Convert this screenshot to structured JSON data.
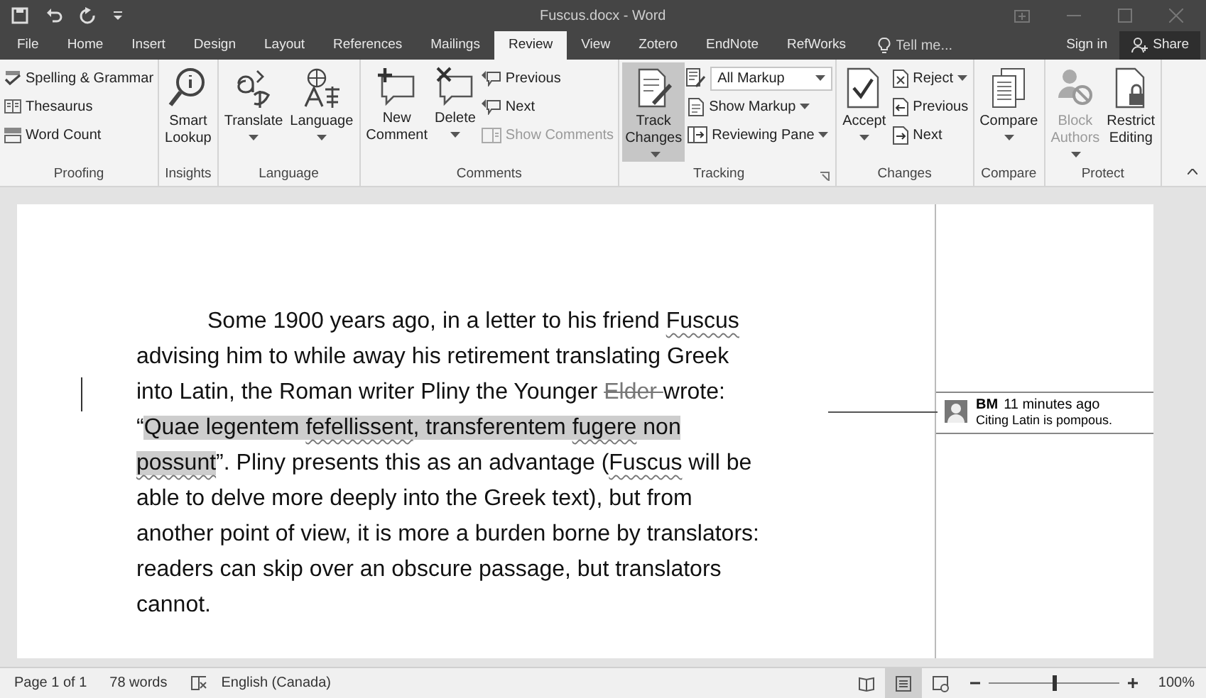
{
  "window": {
    "title": "Fuscus.docx - Word"
  },
  "tabs": [
    {
      "label": "File",
      "selected": false
    },
    {
      "label": "Home",
      "selected": false
    },
    {
      "label": "Insert",
      "selected": false
    },
    {
      "label": "Design",
      "selected": false
    },
    {
      "label": "Layout",
      "selected": false
    },
    {
      "label": "References",
      "selected": false
    },
    {
      "label": "Mailings",
      "selected": false
    },
    {
      "label": "Review",
      "selected": true
    },
    {
      "label": "View",
      "selected": false
    },
    {
      "label": "Zotero",
      "selected": false
    },
    {
      "label": "EndNote",
      "selected": false
    },
    {
      "label": "RefWorks",
      "selected": false
    }
  ],
  "tell_me": {
    "placeholder": "Tell me..."
  },
  "sign_in": "Sign in",
  "share": "Share",
  "ribbon": {
    "groups": [
      {
        "label": "Proofing",
        "items": [
          {
            "kind": "stack",
            "items": [
              {
                "label": "Spelling & Grammar",
                "kind": "small",
                "disabled": false,
                "pressed": false,
                "dropdown": false
              },
              {
                "label": "Thesaurus",
                "kind": "small",
                "disabled": false,
                "pressed": false,
                "dropdown": false
              },
              {
                "label": "Word Count",
                "kind": "small",
                "disabled": false,
                "pressed": false,
                "dropdown": false
              }
            ]
          }
        ]
      },
      {
        "label": "Insights",
        "items": [
          {
            "kind": "large",
            "label": "Smart Lookup",
            "disabled": false,
            "pressed": false,
            "dropdown": false
          }
        ]
      },
      {
        "label": "Language",
        "items": [
          {
            "kind": "large",
            "label": "Translate",
            "disabled": false,
            "pressed": false,
            "dropdown": true
          },
          {
            "kind": "large",
            "label": "Language",
            "disabled": false,
            "pressed": false,
            "dropdown": true
          }
        ]
      },
      {
        "label": "Comments",
        "items": [
          {
            "kind": "large",
            "label": "New Comment",
            "disabled": false,
            "pressed": false,
            "dropdown": false
          },
          {
            "kind": "large",
            "label": "Delete",
            "disabled": false,
            "pressed": false,
            "dropdown": true
          },
          {
            "kind": "stack",
            "items": [
              {
                "label": "Previous",
                "kind": "small",
                "disabled": false,
                "pressed": false,
                "dropdown": false
              },
              {
                "label": "Next",
                "kind": "small",
                "disabled": false,
                "pressed": false,
                "dropdown": false
              },
              {
                "label": "Show Comments",
                "kind": "small",
                "disabled": true,
                "pressed": false,
                "dropdown": false
              }
            ]
          }
        ]
      },
      {
        "label": "Tracking",
        "items": [
          {
            "kind": "large",
            "label": "Track Changes",
            "disabled": false,
            "pressed": true,
            "dropdown": true
          },
          {
            "kind": "stack",
            "items": [
              {
                "label": "All Markup",
                "kind": "select",
                "disabled": false,
                "pressed": false,
                "dropdown": true
              },
              {
                "label": "Show Markup",
                "kind": "small",
                "disabled": false,
                "pressed": false,
                "dropdown": true
              },
              {
                "label": "Reviewing Pane",
                "kind": "small",
                "disabled": false,
                "pressed": false,
                "dropdown": true
              }
            ]
          }
        ]
      },
      {
        "label": "Changes",
        "items": [
          {
            "kind": "large",
            "label": "Accept",
            "disabled": false,
            "pressed": false,
            "dropdown": true
          },
          {
            "kind": "stack",
            "items": [
              {
                "label": "Reject",
                "kind": "small",
                "disabled": false,
                "pressed": false,
                "dropdown": true
              },
              {
                "label": "Previous",
                "kind": "small",
                "disabled": false,
                "pressed": false,
                "dropdown": false
              },
              {
                "label": "Next",
                "kind": "small",
                "disabled": false,
                "pressed": false,
                "dropdown": false
              }
            ]
          }
        ]
      },
      {
        "label": "Compare",
        "items": [
          {
            "kind": "large",
            "label": "Compare",
            "disabled": false,
            "pressed": false,
            "dropdown": true
          }
        ]
      },
      {
        "label": "Protect",
        "items": [
          {
            "kind": "large",
            "label": "Block Authors",
            "disabled": true,
            "pressed": false,
            "dropdown": true
          },
          {
            "kind": "large",
            "label": "Restrict Editing",
            "disabled": false,
            "pressed": false,
            "dropdown": false
          }
        ]
      }
    ]
  },
  "document": {
    "paragraph": [
      [
        {
          "text": "Some 1900 years ago, in a letter to his friend ",
          "kind": "normal"
        },
        {
          "text": "Fuscus",
          "kind": "misspelled"
        }
      ],
      [
        {
          "text": "advising him to while away his retirement translating Greek",
          "kind": "normal"
        }
      ],
      [
        {
          "text": "into Latin, the Roman writer Pliny the Younger ",
          "kind": "normal"
        },
        {
          "text": "Elder ",
          "kind": "deleted"
        },
        {
          "text": "wrote:",
          "kind": "normal"
        }
      ],
      [
        {
          "text": "“",
          "kind": "normal"
        },
        {
          "text": "Quae legentem ",
          "kind": "comment"
        },
        {
          "text": "fefellissent",
          "kind": "comment-misspelled"
        },
        {
          "text": ", transferentem ",
          "kind": "comment"
        },
        {
          "text": "fugere",
          "kind": "comment-misspelled"
        },
        {
          "text": " non",
          "kind": "comment"
        }
      ],
      [
        {
          "text": "possunt",
          "kind": "comment-misspelled"
        },
        {
          "text": "”. Pliny presents this as an advantage (",
          "kind": "normal"
        },
        {
          "text": "Fuscus",
          "kind": "misspelled"
        },
        {
          "text": " will be",
          "kind": "normal"
        }
      ],
      [
        {
          "text": "able to delve more deeply into the Greek text), but from",
          "kind": "normal"
        }
      ],
      [
        {
          "text": "another point of view, it is more a burden borne by translators:",
          "kind": "normal"
        }
      ],
      [
        {
          "text": "readers can skip over an obscure passage, but translators",
          "kind": "normal"
        }
      ],
      [
        {
          "text": "cannot.",
          "kind": "normal"
        }
      ]
    ],
    "comment": {
      "author": "BM",
      "time": "11 minutes ago",
      "text": "Citing Latin is pompous."
    }
  },
  "status_bar": {
    "page": "Page 1 of 1",
    "words": "78 words",
    "language": "English (Canada)",
    "views": [
      {
        "selected": false
      },
      {
        "selected": true
      },
      {
        "selected": false
      }
    ],
    "zoom": {
      "level": 0.5
    },
    "zoom_label": "100%"
  }
}
